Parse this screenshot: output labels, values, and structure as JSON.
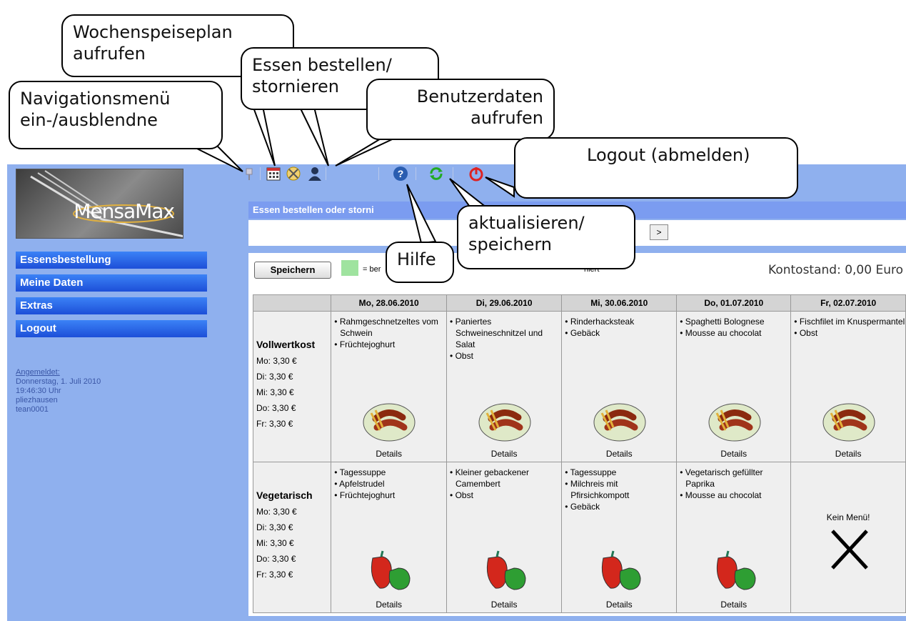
{
  "toolbar": {
    "icons": [
      "pin-icon",
      "calendar-icon",
      "cutlery-icon",
      "user-icon",
      "help-icon",
      "refresh-icon",
      "power-icon"
    ]
  },
  "sidebar": {
    "logo_text": "MensaMax",
    "items": [
      {
        "label": "Essensbestellung"
      },
      {
        "label": "Meine Daten"
      },
      {
        "label": "Extras"
      },
      {
        "label": "Logout"
      }
    ],
    "login": {
      "heading": "Angemeldet:",
      "date": "Donnerstag, 1. Juli 2010",
      "time": "19:46:30 Uhr",
      "place": "pliezhausen",
      "user": "tean0001"
    }
  },
  "content": {
    "title": "Essen bestellen oder storni",
    "next_label": ">",
    "save_label": "Speichern",
    "legend_ordered": "= ber",
    "legend_cancelled": "niert",
    "balance": "Kontostand: 0,00 Euro"
  },
  "days": [
    "Mo, 28.06.2010",
    "Di, 29.06.2010",
    "Mi, 30.06.2010",
    "Do, 01.07.2010",
    "Fr, 02.07.2010"
  ],
  "lines": [
    {
      "name": "Vollwertkost",
      "prices": [
        "Mo: 3,30 €",
        "Di:  3,30 €",
        "Mi:  3,30 €",
        "Do: 3,30 €",
        "Fr:  3,30 €"
      ],
      "meals": [
        {
          "items": [
            "Rahmgeschnetzeltes vom Schwein",
            "Früchtejoghurt"
          ],
          "details": "Details"
        },
        {
          "items": [
            "Paniertes Schweineschnitzel und Salat",
            "Obst"
          ],
          "details": "Details"
        },
        {
          "items": [
            "Rinderhacksteak",
            "Gebäck"
          ],
          "details": "Details"
        },
        {
          "items": [
            "Spaghetti Bolognese",
            "Mousse au chocolat"
          ],
          "details": "Details"
        },
        {
          "items": [
            "Fischfilet im Knuspermantel",
            "Obst"
          ],
          "details": "Details"
        }
      ]
    },
    {
      "name": "Vegetarisch",
      "prices": [
        "Mo: 3,30 €",
        "Di:  3,30 €",
        "Mi:  3,30 €",
        "Do: 3,30 €",
        "Fr:  3,30 €"
      ],
      "meals": [
        {
          "items": [
            "Tagessuppe",
            "Apfelstrudel",
            "Früchtejoghurt"
          ],
          "details": "Details"
        },
        {
          "items": [
            "Kleiner gebackener Camembert",
            "Obst"
          ],
          "details": "Details"
        },
        {
          "items": [
            "Tagessuppe",
            "Milchreis mit Pfirsichkompott",
            "Gebäck"
          ],
          "details": "Details"
        },
        {
          "items": [
            "Vegetarisch gefüllter Paprika",
            "Mousse au chocolat"
          ],
          "details": "Details"
        },
        {
          "items": [],
          "details": "",
          "no_menu": "Kein Menü!"
        }
      ]
    }
  ],
  "callouts": {
    "wochenspeiseplan": "Wochenspeiseplan aufrufen",
    "essen": "Essen bestellen/ stornieren",
    "navigation": "Navigationsmenü ein-/ausblendne",
    "benutzer": "Benutzerdaten aufrufen",
    "logout": "Logout (abmelden)",
    "aktualisieren": "aktualisieren/ speichern",
    "hilfe": "Hilfe"
  }
}
